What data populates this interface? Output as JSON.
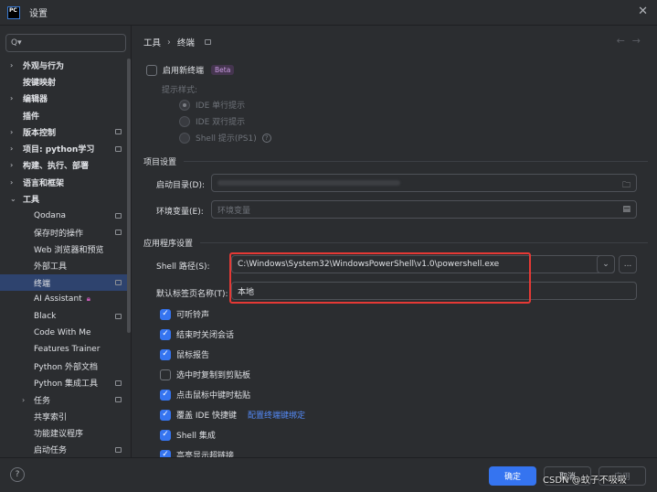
{
  "window": {
    "title": "设置",
    "logo_text": "PC"
  },
  "sidebar": {
    "search_placeholder": "Q▾",
    "items": [
      {
        "label": "外观与行为",
        "bold": true,
        "arrow": true,
        "level": 1
      },
      {
        "label": "按键映射",
        "bold": true,
        "level": 1
      },
      {
        "label": "编辑器",
        "bold": true,
        "arrow": true,
        "level": 1
      },
      {
        "label": "插件",
        "bold": true,
        "level": 1
      },
      {
        "label": "版本控制",
        "bold": true,
        "arrow": true,
        "level": 1,
        "proj": true
      },
      {
        "label": "项目: python学习",
        "bold": true,
        "arrow": true,
        "level": 1,
        "proj": true
      },
      {
        "label": "构建、执行、部署",
        "bold": true,
        "arrow": true,
        "level": 1
      },
      {
        "label": "语言和框架",
        "bold": true,
        "arrow": true,
        "level": 1
      },
      {
        "label": "工具",
        "bold": true,
        "arrow": true,
        "expanded": true,
        "level": 1
      },
      {
        "label": "Qodana",
        "level": 2,
        "proj": true
      },
      {
        "label": "保存时的操作",
        "level": 2,
        "proj": true
      },
      {
        "label": "Web 浏览器和预览",
        "level": 2
      },
      {
        "label": "外部工具",
        "level": 2
      },
      {
        "label": "终端",
        "level": 2,
        "proj": true,
        "selected": true
      },
      {
        "label": "AI Assistant",
        "level": 2,
        "lock": true
      },
      {
        "label": "Black",
        "level": 2,
        "proj": true
      },
      {
        "label": "Code With Me",
        "level": 2
      },
      {
        "label": "Features Trainer",
        "level": 2
      },
      {
        "label": "Python 外部文档",
        "level": 2
      },
      {
        "label": "Python 集成工具",
        "level": 2,
        "proj": true
      },
      {
        "label": "任务",
        "level": 2,
        "arrow": true,
        "proj": true
      },
      {
        "label": "共享索引",
        "level": 2
      },
      {
        "label": "功能建议程序",
        "level": 2
      },
      {
        "label": "启动任务",
        "level": 2,
        "proj": true
      }
    ]
  },
  "breadcrumb": {
    "parent": "工具",
    "sep": "›",
    "current": "终端"
  },
  "nav": {
    "back": "←",
    "forward": "→"
  },
  "new_terminal": {
    "label": "启用新终端",
    "badge": "Beta",
    "checked": false
  },
  "hint_style": {
    "label": "提示样式:",
    "options": [
      {
        "label": "IDE 单行提示",
        "selected": true
      },
      {
        "label": "IDE 双行提示",
        "selected": false
      },
      {
        "label": "Shell 提示(PS1)",
        "selected": false,
        "help": "?"
      }
    ]
  },
  "project_settings": {
    "title": "项目设置",
    "start_dir_label": "启动目录(D):",
    "env_label": "环境变量(E):",
    "env_placeholder": "环境变量"
  },
  "app_settings": {
    "title": "应用程序设置",
    "shell_path_label": "Shell 路径(S):",
    "shell_path_value": "C:\\Windows\\System32\\WindowsPowerShell\\v1.0\\powershell.exe",
    "tab_name_label": "默认标签页名称(T):",
    "tab_name_value": "本地",
    "browse_label": "..."
  },
  "options": [
    {
      "label": "可听铃声",
      "checked": true
    },
    {
      "label": "结束时关闭会话",
      "checked": true
    },
    {
      "label": "鼠标报告",
      "checked": true
    },
    {
      "label": "选中时复制到剪贴板",
      "checked": false
    },
    {
      "label": "点击鼠标中键时粘贴",
      "checked": true
    },
    {
      "label": "覆盖 IDE 快捷键",
      "checked": true,
      "link": "配置终端键绑定"
    },
    {
      "label": "Shell 集成",
      "checked": true
    },
    {
      "label": "高亮显示超链接",
      "checked": true
    }
  ],
  "footer": {
    "help": "?",
    "ok": "确定",
    "cancel": "取消",
    "apply": "应用"
  },
  "watermark": "CSDN @蚊子不吸吸",
  "colors": {
    "accent": "#3574f0",
    "highlight_box": "#e53935",
    "selection": "#2e436e"
  }
}
